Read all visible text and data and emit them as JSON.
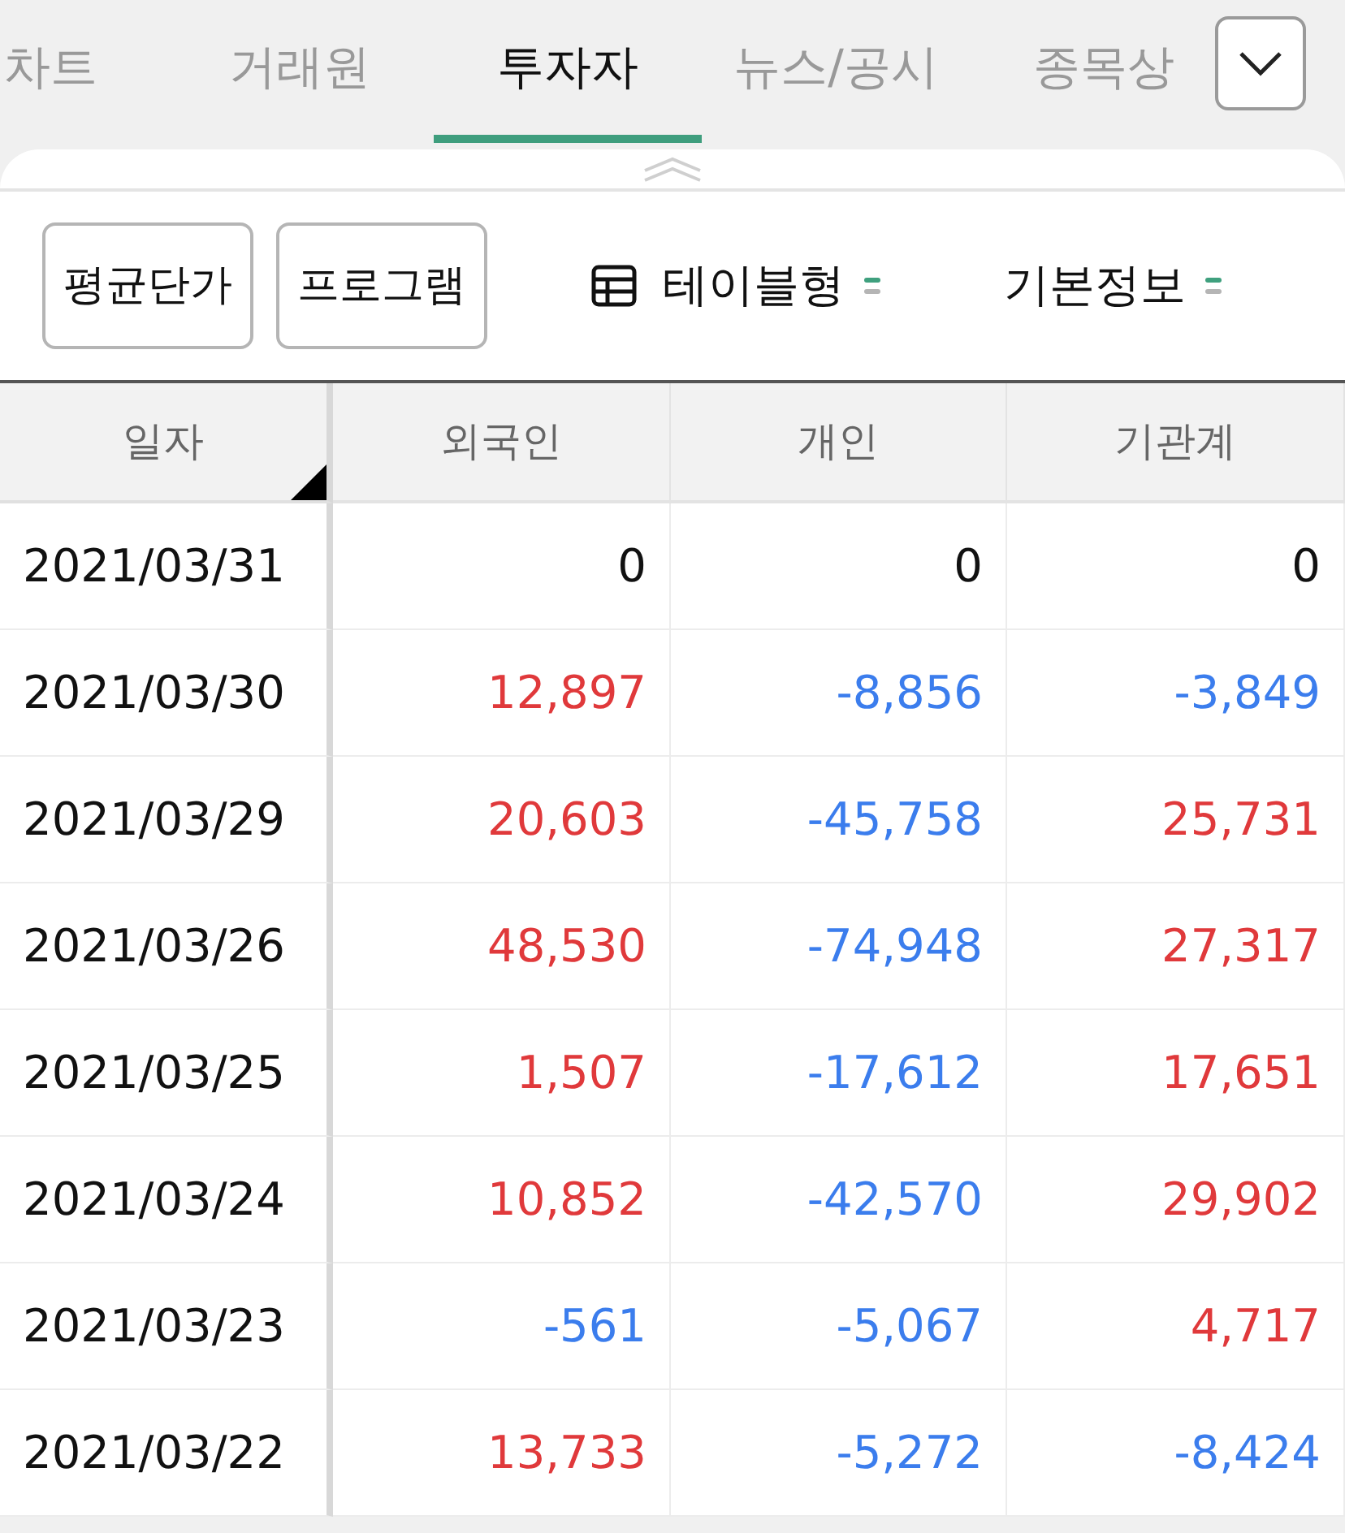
{
  "tabs": [
    {
      "label": "차트",
      "selected": false
    },
    {
      "label": "거래원",
      "selected": false
    },
    {
      "label": "투자자",
      "selected": true
    },
    {
      "label": "뉴스/공시",
      "selected": false
    },
    {
      "label": "종목상",
      "selected": false
    }
  ],
  "toolbar": {
    "buttons": [
      "평균단가",
      "프로그램"
    ],
    "view_select": "테이블형",
    "info_select": "기본정보"
  },
  "table": {
    "columns": [
      "일자",
      "외국인",
      "개인",
      "기관계"
    ],
    "rows": [
      {
        "cells": [
          {
            "text": "2021/03/31"
          },
          {
            "text": "0",
            "color": "#111111"
          },
          {
            "text": "0",
            "color": "#111111"
          },
          {
            "text": "0",
            "color": "#111111"
          }
        ]
      },
      {
        "cells": [
          {
            "text": "2021/03/30"
          },
          {
            "text": "12,897",
            "color": "#e0393b"
          },
          {
            "text": "-8,856",
            "color": "#3b7ded"
          },
          {
            "text": "-3,849",
            "color": "#3b7ded"
          }
        ]
      },
      {
        "cells": [
          {
            "text": "2021/03/29"
          },
          {
            "text": "20,603",
            "color": "#e0393b"
          },
          {
            "text": "-45,758",
            "color": "#3b7ded"
          },
          {
            "text": "25,731",
            "color": "#e0393b"
          }
        ]
      },
      {
        "cells": [
          {
            "text": "2021/03/26"
          },
          {
            "text": "48,530",
            "color": "#e0393b"
          },
          {
            "text": "-74,948",
            "color": "#3b7ded"
          },
          {
            "text": "27,317",
            "color": "#e0393b"
          }
        ]
      },
      {
        "cells": [
          {
            "text": "2021/03/25"
          },
          {
            "text": "1,507",
            "color": "#e0393b"
          },
          {
            "text": "-17,612",
            "color": "#3b7ded"
          },
          {
            "text": "17,651",
            "color": "#e0393b"
          }
        ]
      },
      {
        "cells": [
          {
            "text": "2021/03/24"
          },
          {
            "text": "10,852",
            "color": "#e0393b"
          },
          {
            "text": "-42,570",
            "color": "#3b7ded"
          },
          {
            "text": "29,902",
            "color": "#e0393b"
          }
        ]
      },
      {
        "cells": [
          {
            "text": "2021/03/23"
          },
          {
            "text": "-561",
            "color": "#3b7ded"
          },
          {
            "text": "-5,067",
            "color": "#3b7ded"
          },
          {
            "text": "4,717",
            "color": "#e0393b"
          }
        ]
      },
      {
        "cells": [
          {
            "text": "2021/03/22"
          },
          {
            "text": "13,733",
            "color": "#e0393b"
          },
          {
            "text": "-5,272",
            "color": "#3b7ded"
          },
          {
            "text": "-8,424",
            "color": "#3b7ded"
          }
        ]
      }
    ]
  }
}
